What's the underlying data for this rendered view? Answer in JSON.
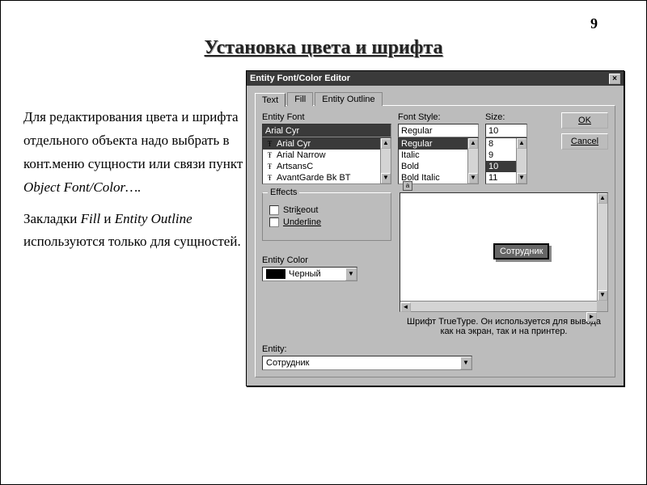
{
  "page_number": "9",
  "title": "Установка цвета и шрифта",
  "body": {
    "p1a": "Для редактирования цвета и шрифта отдельного объекта надо выбрать в конт.меню сущности или связи пункт ",
    "p1b": "Object Font/Color….",
    "p2a": "Закладки ",
    "p2b": "Fill",
    "p2c": " и ",
    "p2d": "Entity Outline",
    "p2e": " используются только для сущностей."
  },
  "dialog": {
    "title": "Entity Font/Color Editor",
    "tabs": {
      "text": "Text",
      "fill": "Fill",
      "outline": "Entity Outline"
    },
    "labels": {
      "entity_font": "Entity Font",
      "font_style": "Font Style:",
      "size": "Size:",
      "effects": "Effects",
      "strikeout": "Strikeout",
      "underline": "Underline",
      "entity_color": "Entity Color",
      "entity": "Entity:"
    },
    "font_input": "Arial Cyr",
    "font_list": [
      "Arial Cyr",
      "Arial Narrow",
      "ArtsansC",
      "AvantGarde Bk BT"
    ],
    "font_selected": 0,
    "style_input": "Regular",
    "style_list": [
      "Regular",
      "Italic",
      "Bold",
      "Bold Italic"
    ],
    "style_selected": 0,
    "size_input": "10",
    "size_list": [
      "8",
      "9",
      "10",
      "11"
    ],
    "size_selected": 2,
    "buttons": {
      "ok": "OK",
      "cancel": "Cancel"
    },
    "color_name": "Черный",
    "preview_entity": "Сотрудник",
    "hint": "Шрифт TrueType. Он используется для вывода как на экран, так и на принтер.",
    "entity_value": "Сотрудник"
  }
}
